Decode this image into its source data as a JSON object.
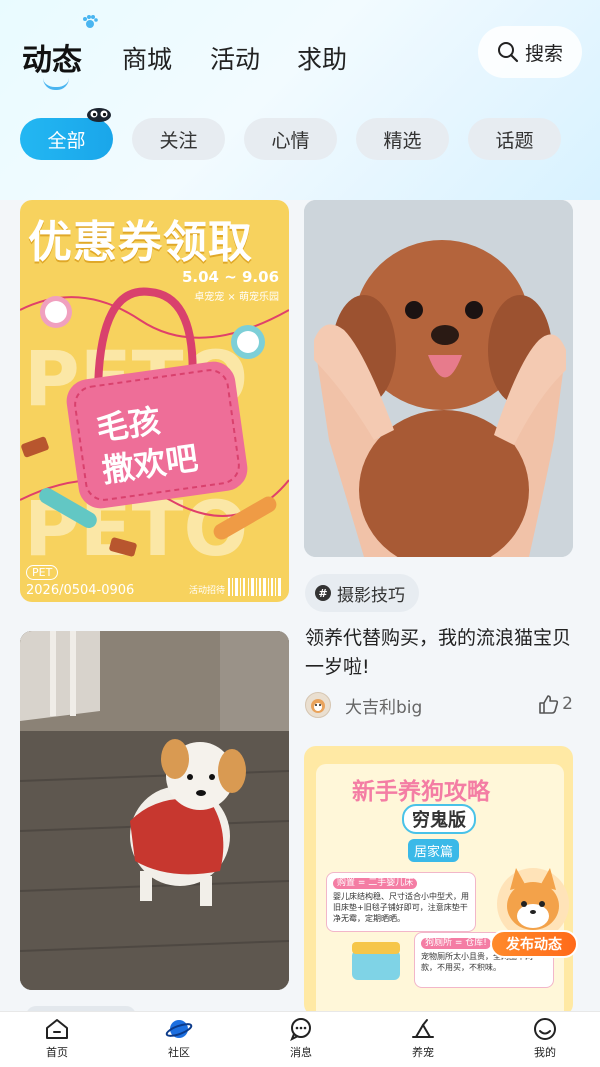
{
  "header": {
    "tabs": [
      {
        "label": "动态",
        "active": true
      },
      {
        "label": "商城",
        "active": false
      },
      {
        "label": "活动",
        "active": false
      },
      {
        "label": "求助",
        "active": false
      }
    ],
    "search_label": "搜索",
    "search_icon": "search-icon"
  },
  "filters": [
    {
      "label": "全部",
      "active": true
    },
    {
      "label": "关注",
      "active": false
    },
    {
      "label": "心情",
      "active": false
    },
    {
      "label": "精选",
      "active": false
    },
    {
      "label": "话题",
      "active": false
    }
  ],
  "feed": {
    "coupon_card": {
      "title": "优惠券领取",
      "dates": "5.04 ~ 9.06",
      "sub": "卓宠宠 × 萌宠乐园",
      "bag_line1": "毛孩",
      "bag_line2": "撒欢吧",
      "bg_word": "PETO",
      "pet_tag": "PET",
      "code": "2026/0504-0906",
      "tiny": "活动招待"
    },
    "poodle_post": {
      "hashtag": "摄影技巧",
      "title": "领养代替购买，我的流浪猫宝贝一岁啦!",
      "author": "大吉利big",
      "likes": "2"
    },
    "guide_card": {
      "title": "新手养狗攻略",
      "subtitle": "穷鬼版",
      "tag": "居家篇",
      "box1_label": "购置 = 二手婴儿床",
      "box1_text": "婴儿床结构稳、尺寸适合小中型犬，用旧床垫+旧毯子铺好即可，注意床垫干净无霉，定期晒晒。",
      "box2_label": "狗厕所 = 仓库!",
      "box2_text": "宠物厕所太小且贵，全网圈中两款，不用买，不积味。"
    }
  },
  "fab": {
    "label": "发布动态"
  },
  "bottom_nav": [
    {
      "label": "首页",
      "icon": "home-icon"
    },
    {
      "label": "社区",
      "icon": "planet-icon"
    },
    {
      "label": "消息",
      "icon": "message-icon"
    },
    {
      "label": "养宠",
      "icon": "pet-care-icon"
    },
    {
      "label": "我的",
      "icon": "profile-icon"
    }
  ],
  "colors": {
    "accent": "#1aa6ea",
    "fab": "#ff7a22",
    "coupon_bg": "#f7d25e"
  }
}
